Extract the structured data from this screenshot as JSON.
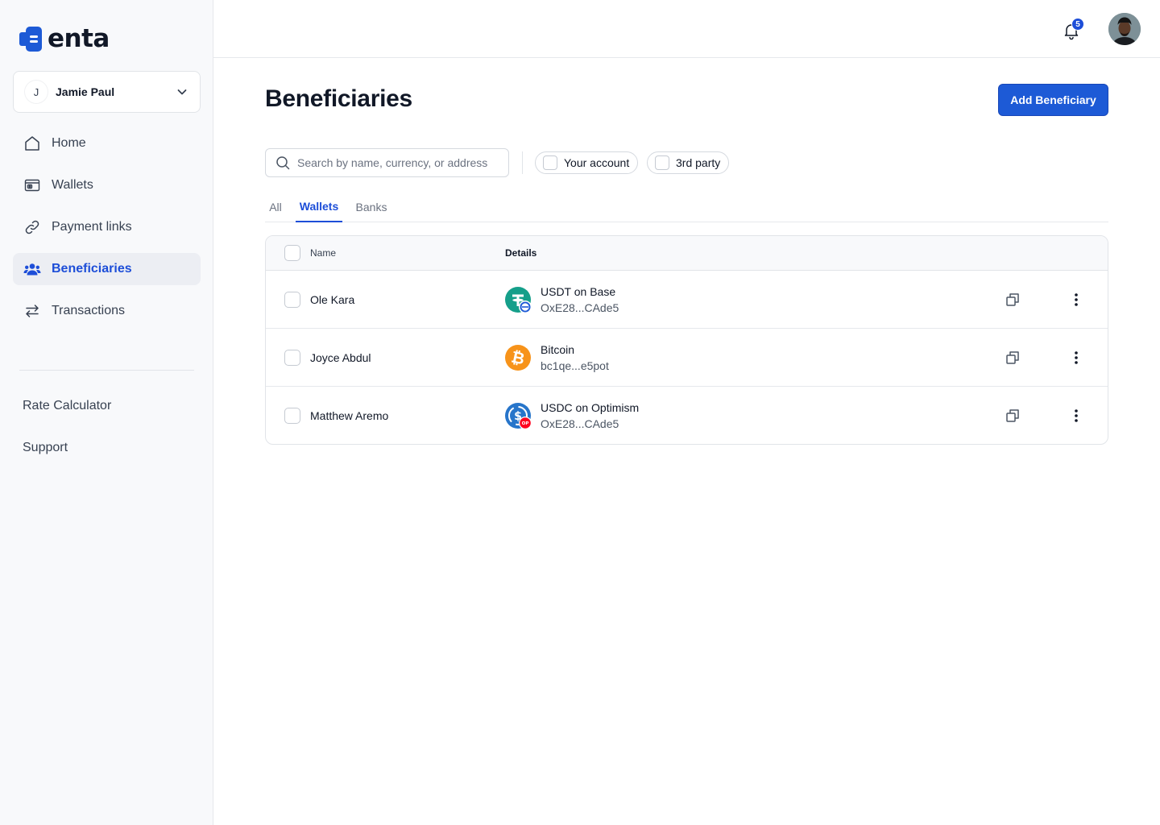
{
  "brand": {
    "name": "enta",
    "color": "#1d5ad6"
  },
  "account": {
    "initial": "J",
    "name": "Jamie Paul"
  },
  "nav": {
    "items": [
      {
        "label": "Home",
        "icon": "home-icon"
      },
      {
        "label": "Wallets",
        "icon": "wallet-icon"
      },
      {
        "label": "Payment links",
        "icon": "link-icon"
      },
      {
        "label": "Beneficiaries",
        "icon": "users-icon",
        "active": true
      },
      {
        "label": "Transactions",
        "icon": "arrows-exchange-icon"
      }
    ],
    "lower": [
      {
        "label": "Rate Calculator"
      },
      {
        "label": "Support"
      }
    ]
  },
  "topbar": {
    "notification_count": "5"
  },
  "page": {
    "title": "Beneficiaries",
    "add_button": "Add Beneficiary"
  },
  "search": {
    "placeholder": "Search by name, currency, or address",
    "value": ""
  },
  "filters": [
    {
      "label": "Your account",
      "checked": false
    },
    {
      "label": "3rd party",
      "checked": false
    }
  ],
  "tabs": [
    {
      "label": "All"
    },
    {
      "label": "Wallets",
      "active": true
    },
    {
      "label": "Banks"
    }
  ],
  "table": {
    "headers": {
      "name": "Name",
      "details": "Details"
    },
    "rows": [
      {
        "name": "Ole Kara",
        "asset": "USDT on Base",
        "address": "OxE28...CAde5",
        "coin_icon": "usdt-base-icon"
      },
      {
        "name": "Joyce Abdul",
        "asset": "Bitcoin",
        "address": "bc1qe...e5pot",
        "coin_icon": "bitcoin-icon"
      },
      {
        "name": "Matthew Aremo",
        "asset": "USDC on Optimism",
        "address": "OxE28...CAde5",
        "coin_icon": "usdc-optimism-icon"
      }
    ]
  },
  "coin_badge_text": "OP"
}
